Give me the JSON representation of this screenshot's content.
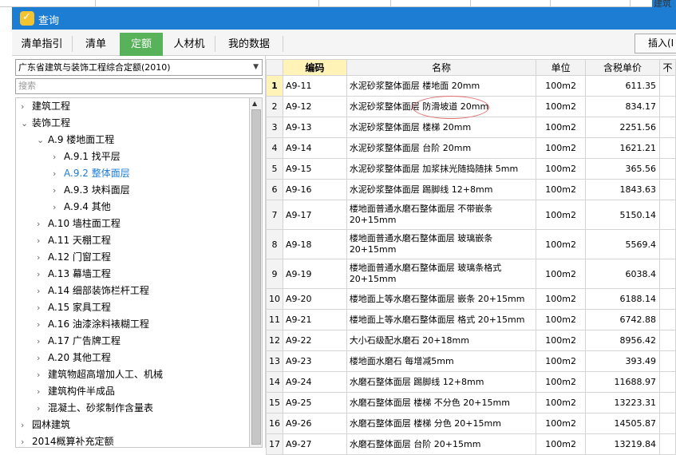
{
  "window": {
    "title": "查询"
  },
  "background": {
    "right_fragment": "建筑"
  },
  "tabs": [
    {
      "label": "清单指引"
    },
    {
      "label": "清单"
    },
    {
      "label": "定额"
    },
    {
      "label": "人材机"
    },
    {
      "label": "我的数据"
    }
  ],
  "toolbar": {
    "insert_label": "插入(I"
  },
  "left": {
    "combo_value": "广东省建筑与装饰工程综合定额(2010)",
    "search_placeholder": "搜索",
    "tree": [
      {
        "label": "建筑工程",
        "chev": "›"
      },
      {
        "label": "装饰工程",
        "chev": "⌄"
      },
      {
        "label": "A.9 楼地面工程",
        "chev": "⌄"
      },
      {
        "label": "A.9.1 找平层",
        "chev": "›"
      },
      {
        "label": "A.9.2 整体面层",
        "chev": "›"
      },
      {
        "label": "A.9.3 块料面层",
        "chev": "›"
      },
      {
        "label": "A.9.4 其他",
        "chev": "›"
      },
      {
        "label": "A.10 墙柱面工程",
        "chev": "›"
      },
      {
        "label": "A.11 天棚工程",
        "chev": "›"
      },
      {
        "label": "A.12 门窗工程",
        "chev": "›"
      },
      {
        "label": "A.13 幕墙工程",
        "chev": "›"
      },
      {
        "label": "A.14 细部装饰栏杆工程",
        "chev": "›"
      },
      {
        "label": "A.15 家具工程",
        "chev": "›"
      },
      {
        "label": "A.16 油漆涂料裱糊工程",
        "chev": "›"
      },
      {
        "label": "A.17 广告牌工程",
        "chev": "›"
      },
      {
        "label": "A.20 其他工程",
        "chev": "›"
      },
      {
        "label": "建筑物超高增加人工、机械",
        "chev": "›"
      },
      {
        "label": "建筑构件半成品",
        "chev": "›"
      },
      {
        "label": "混凝土、砂浆制作含量表",
        "chev": "›"
      },
      {
        "label": "园林建筑",
        "chev": "›"
      },
      {
        "label": "2014概算补充定额",
        "chev": "›"
      }
    ]
  },
  "grid": {
    "headers": {
      "code": "编码",
      "name": "名称",
      "unit": "单位",
      "price": "含税单价",
      "extra": "不"
    },
    "rows": [
      {
        "num": "1",
        "code": "A9-11",
        "name": "水泥砂浆整体面层 楼地面 20mm",
        "unit": "100m2",
        "price": "611.35"
      },
      {
        "num": "2",
        "code": "A9-12",
        "name": "水泥砂浆整体面层 防滑坡道 20mm",
        "unit": "100m2",
        "price": "834.17"
      },
      {
        "num": "3",
        "code": "A9-13",
        "name": "水泥砂浆整体面层 楼梯 20mm",
        "unit": "100m2",
        "price": "2251.56"
      },
      {
        "num": "4",
        "code": "A9-14",
        "name": "水泥砂浆整体面层 台阶 20mm",
        "unit": "100m2",
        "price": "1621.21"
      },
      {
        "num": "5",
        "code": "A9-15",
        "name": "水泥砂浆整体面层 加浆抹光随捣随抹 5mm",
        "unit": "100m2",
        "price": "365.56"
      },
      {
        "num": "6",
        "code": "A9-16",
        "name": "水泥砂浆整体面层 踢脚线 12+8mm",
        "unit": "100m2",
        "price": "1843.63"
      },
      {
        "num": "7",
        "code": "A9-17",
        "name": "楼地面普通水磨石整体面层 不带嵌条 20+15mm",
        "unit": "100m2",
        "price": "5150.14"
      },
      {
        "num": "8",
        "code": "A9-18",
        "name": "楼地面普通水磨石整体面层 玻璃嵌条 20+15mm",
        "unit": "100m2",
        "price": "5569.4"
      },
      {
        "num": "9",
        "code": "A9-19",
        "name": "楼地面普通水磨石整体面层 玻璃条格式 20+15mm",
        "unit": "100m2",
        "price": "6038.4"
      },
      {
        "num": "10",
        "code": "A9-20",
        "name": "楼地面上等水磨石整体面层 嵌条 20+15mm",
        "unit": "100m2",
        "price": "6188.14"
      },
      {
        "num": "11",
        "code": "A9-21",
        "name": "楼地面上等水磨石整体面层 格式 20+15mm",
        "unit": "100m2",
        "price": "6742.88"
      },
      {
        "num": "12",
        "code": "A9-22",
        "name": "大小石级配水磨石 20+18mm",
        "unit": "100m2",
        "price": "8956.42"
      },
      {
        "num": "13",
        "code": "A9-23",
        "name": "楼地面水磨石 每增减5mm",
        "unit": "100m2",
        "price": "393.49"
      },
      {
        "num": "14",
        "code": "A9-24",
        "name": "水磨石整体面层 踢脚线 12+8mm",
        "unit": "100m2",
        "price": "11688.97"
      },
      {
        "num": "15",
        "code": "A9-25",
        "name": "水磨石整体面层 楼梯 不分色 20+15mm",
        "unit": "100m2",
        "price": "13223.31"
      },
      {
        "num": "16",
        "code": "A9-26",
        "name": "水磨石整体面层 楼梯 分色 20+15mm",
        "unit": "100m2",
        "price": "14505.87"
      },
      {
        "num": "17",
        "code": "A9-27",
        "name": "水磨石整体面层 台阶 20+15mm",
        "unit": "100m2",
        "price": "13219.84"
      }
    ]
  }
}
